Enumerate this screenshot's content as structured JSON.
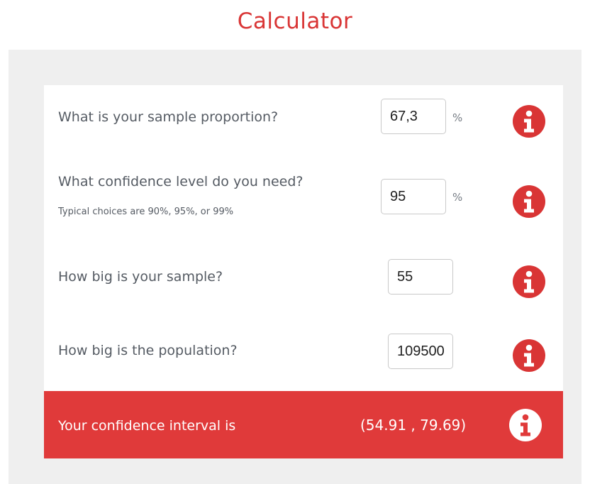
{
  "title": "Calculator",
  "questions": [
    {
      "label": "What is your sample proportion?",
      "value": "67,3",
      "unit": "%"
    },
    {
      "label": "What confidence level do you need?",
      "hint": "Typical choices are 90%, 95%, or 99%",
      "value": "95",
      "unit": "%"
    },
    {
      "label": "How big is your sample?",
      "value": "55"
    },
    {
      "label": "How big is the population?",
      "value": "109500"
    }
  ],
  "result": {
    "label": "Your confidence interval is",
    "value": "(54.91 , 79.69)"
  },
  "icons": {
    "info": "info-circle-icon"
  },
  "colors": {
    "accent": "#d93535",
    "result_bg": "#e03a3a",
    "panel_bg": "#efefef",
    "text": "#555b63"
  }
}
